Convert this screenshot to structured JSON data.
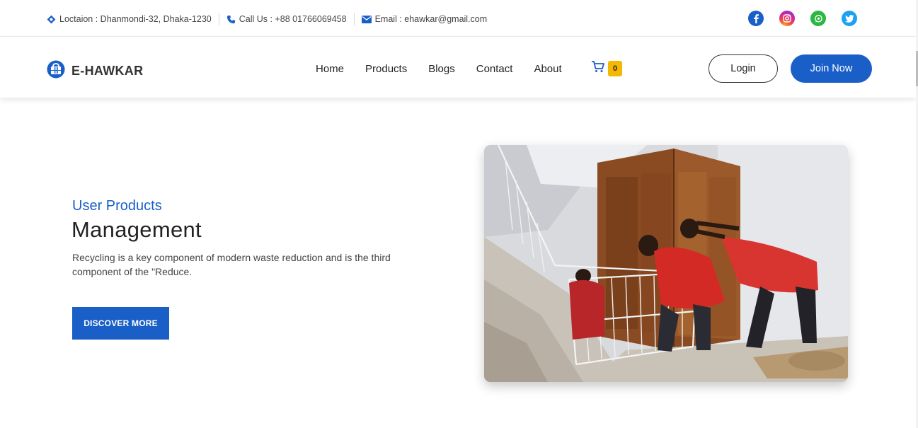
{
  "topbar": {
    "location": "Loctaion : Dhanmondi-32, Dhaka-1230",
    "phone": "Call Us : +88 01766069458",
    "email": "Email : ehawkar@gmail.com",
    "socials": [
      {
        "name": "facebook",
        "icon": "f",
        "color": "#1a5fc8"
      },
      {
        "name": "instagram",
        "icon": "◎",
        "color": "#e0337a"
      },
      {
        "name": "whatsapp",
        "icon": "✆",
        "color": "#2cb742"
      },
      {
        "name": "twitter",
        "icon": "✓",
        "color": "#1da1f2"
      }
    ]
  },
  "nav": {
    "brand": "E-HAWKAR",
    "menu": [
      "Home",
      "Products",
      "Blogs",
      "Contact",
      "About"
    ],
    "cart_count": "0",
    "login": "Login",
    "join": "Join Now"
  },
  "hero": {
    "subtitle": "User Products",
    "title": "Management",
    "description": "Recycling is a key component of modern waste reduction and is the third component of the \"Reduce.",
    "cta": "DISCOVER MORE"
  },
  "colors": {
    "accent": "#1a5fc8",
    "badge": "#f5b800"
  }
}
